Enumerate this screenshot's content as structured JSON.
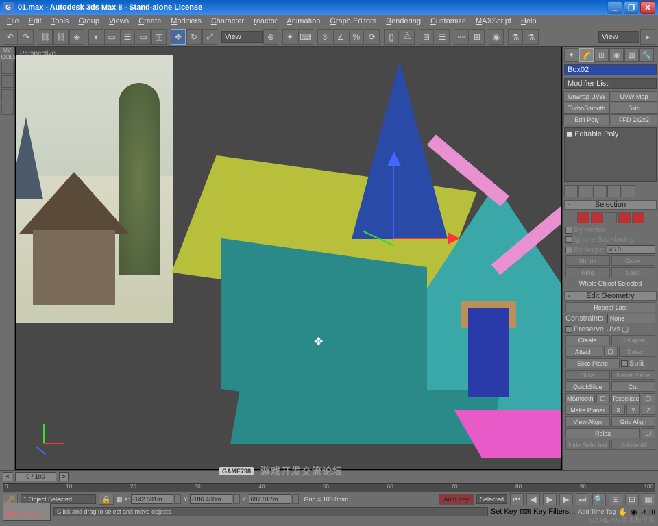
{
  "title": "01.max - Autodesk 3ds Max 8  - Stand-alone License",
  "menubar": [
    "File",
    "Edit",
    "Tools",
    "Group",
    "Views",
    "Create",
    "Modifiers",
    "Character",
    "reactor",
    "Animation",
    "Graph Editors",
    "Rendering",
    "Customize",
    "MAXScript",
    "Help"
  ],
  "toolbar": {
    "view_label": "View"
  },
  "leftbar": {
    "uv": "UV",
    "tools": "TOOLS"
  },
  "viewport": {
    "label": "Perspective"
  },
  "cmd": {
    "object_name": "Box02",
    "modifier_list": "Modifier List",
    "modbtns": [
      "Unwrap UVW",
      "UVW Map",
      "TurboSmooth",
      "Skin",
      "Edit Poly",
      "FFD 2x2x2"
    ],
    "stack_item": "Editable Poly",
    "selection": {
      "title": "Selection",
      "by_vertex": "By Vertex",
      "ignore_backfacing": "Ignore Backfacing",
      "by_angle": "By Angle:",
      "angle_val": "45.0",
      "shrink": "Shrink",
      "grow": "Grow",
      "ring": "Ring",
      "loop": "Loop",
      "status": "Whole Object Selected"
    },
    "editgeom": {
      "title": "Edit Geometry",
      "repeat": "Repeat Last",
      "constraints_lbl": "Constraints:",
      "constraints_val": "None",
      "preserve_uvs": "Preserve UVs",
      "create": "Create",
      "collapse": "Collapse",
      "attach": "Attach",
      "detach": "Detach",
      "slice_plane": "Slice Plane",
      "split": "Split",
      "slice": "Slice",
      "reset_plane": "Reset Plane",
      "quickslice": "QuickSlice",
      "cut": "Cut",
      "msmooth": "MSmooth",
      "tessellate": "Tessellate",
      "make_planar": "Make Planar",
      "x": "X",
      "y": "Y",
      "z": "Z",
      "view_align": "View Align",
      "grid_align": "Grid Align",
      "relax": "Relax",
      "hide_sel": "Hide Selected",
      "unhide_all": "Unhide All"
    }
  },
  "timeline": {
    "frame": "0 / 100",
    "ticks": [
      "0",
      "10",
      "20",
      "30",
      "40",
      "50",
      "60",
      "70",
      "80",
      "90",
      "100"
    ]
  },
  "status": {
    "selection": "1 Object Selected",
    "x": "-142.591m",
    "y": "-186.468m",
    "z": "697.017m",
    "grid": "Grid = 100.0mm",
    "auto_key": "Auto Key",
    "selected": "Selected",
    "set_key": "Set Key",
    "key_filters": "Key Filters..."
  },
  "maxscript": {
    "label": "MAXScript",
    "hint": "Click and drag to select and move objects",
    "addtag": "Add Time Tag"
  },
  "watermarks": {
    "forum": "游戏开发交流论坛",
    "game798": "GAME798",
    "bottom": "GAME798美术教学系"
  }
}
